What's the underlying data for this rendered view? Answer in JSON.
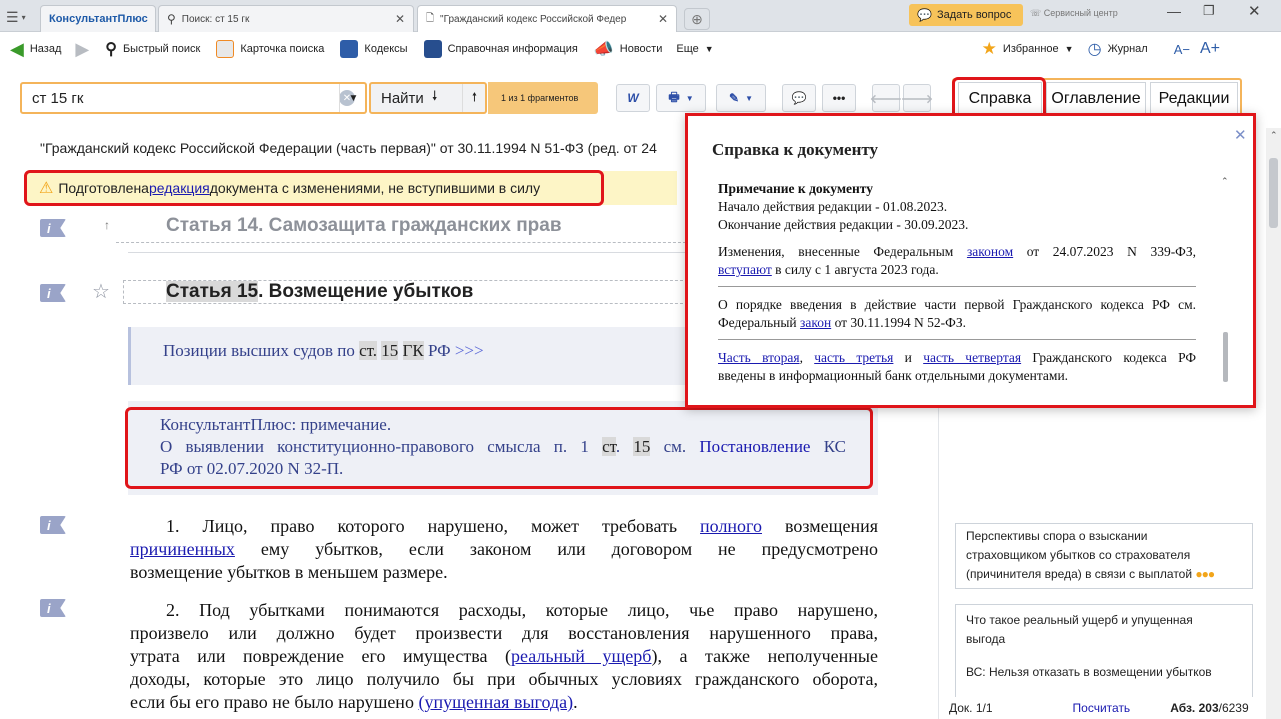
{
  "tabs": {
    "logo": "КонсультантПлюс",
    "search_tab": "Поиск: ст 15 гк",
    "doc_tab": "\"Гражданский кодекс Российской Федер",
    "ask": "Задать вопрос",
    "service": "Сервисный центр"
  },
  "toolbar": {
    "back": "Назад",
    "quick_search": "Быстрый поиск",
    "search_card": "Карточка поиска",
    "codes": "Кодексы",
    "reference": "Справочная информация",
    "news": "Новости",
    "more": "Еще",
    "favorites": "Избранное",
    "journal": "Журнал",
    "font_minus": "A−",
    "font_plus": "A+"
  },
  "search": {
    "value": "ст 15 гк",
    "find": "Найти",
    "fragments": "1 из 1 фрагментов"
  },
  "doctabs": {
    "spravka": "Справка",
    "oglavlenie": "Оглавление",
    "redakcii": "Редакции"
  },
  "doc": {
    "title": "\"Гражданский кодекс Российской Федерации (часть первая)\" от 30.11.1994 N 51-ФЗ (ред. от 24",
    "warning_pre": "Подготовлена ",
    "warning_link": "редакция",
    "warning_post": " документа с изменениями, не вступившими в силу",
    "art14": "Статья 14. Самозащита гражданских прав",
    "art15_a": "Статья ",
    "art15_num": "15",
    "art15_b": ". Возмещение убытков",
    "positions_a": "Позиции высших судов по ",
    "positions_st": "ст.",
    "positions_15": "15",
    "positions_gk": "ГК",
    "positions_rf": " РФ ",
    "positions_more": ">>>",
    "note_title": "КонсультантПлюс: примечание.",
    "note_a": "О выявлении конституционно-правового смысла п. 1 ",
    "note_st": "ст",
    "note_dot": ". ",
    "note_15": "15",
    "note_b": " см. ",
    "note_link": "Постановление",
    "note_c": " КС",
    "note_d": "РФ от 02.07.2020 N 32-П.",
    "p1_a": "1. Лицо, право которого нарушено, может требовать ",
    "p1_l1": "полного",
    "p1_b": " возмещения",
    "p1_l2": "причиненных",
    "p1_c": " ему убытков, если законом или договором не предусмотрено",
    "p1_d": "возмещение убытков в меньшем размере.",
    "p2_1": "2. Под убытками понимаются расходы, которые лицо, чье право нарушено,",
    "p2_2": "произвело или должно будет произвести для восстановления нарушенного права,",
    "p2_3a": "утрата или повреждение его имущества (",
    "p2_3l": "реальный ущерб",
    "p2_3b": "), а также неполученные",
    "p2_4": "доходы, которые это лицо получило бы при обычных условиях гражданского оборота,",
    "p2_5a": "если бы его право не было нарушено ",
    "p2_5l": "(упущенная выгода)",
    "p2_5b": "."
  },
  "popup": {
    "title": "Справка к документу",
    "note_head": "Примечание к документу",
    "start": "Начало действия редакции - 01.08.2023.",
    "end": "Окончание действия редакции - 30.09.2023.",
    "ch_a": "Изменения, внесенные Федеральным ",
    "ch_l": "законом",
    "ch_b": " от 24.07.2023 N 339-ФЗ,",
    "ch_l2": "вступают",
    "ch_c": " в силу с 1 августа 2023 года.",
    "ord_a": "О порядке введения в действие части первой Гражданского кодекса РФ см.",
    "ord_b": "Федеральный ",
    "ord_l": "закон",
    "ord_c": " от 30.11.1994 N 52-ФЗ.",
    "parts_l1": "Часть вторая",
    "parts_s1": ", ",
    "parts_l2": "часть третья",
    "parts_s2": " и ",
    "parts_l3": "часть четвертая",
    "parts_a": " Гражданского кодекса РФ",
    "parts_b": "введены в информационный банк отдельными документами."
  },
  "right": {
    "card1_1": "Перспективы спора о взыскании",
    "card1_2": "страховщиком убытков со страхователя",
    "card1_3": "(причинителя вреда) в связи с выплатой",
    "card2_1": "Что такое реальный ущерб и упущенная",
    "card2_2": "выгода",
    "card2_3": "ВС: Нельзя отказать в возмещении убытков",
    "status_doc": "Док. ",
    "status_doc_n": "1/1",
    "status_count": "Посчитать",
    "status_abz": "Абз. ",
    "status_abz_n": "203",
    "status_abz_total": "/6239"
  }
}
